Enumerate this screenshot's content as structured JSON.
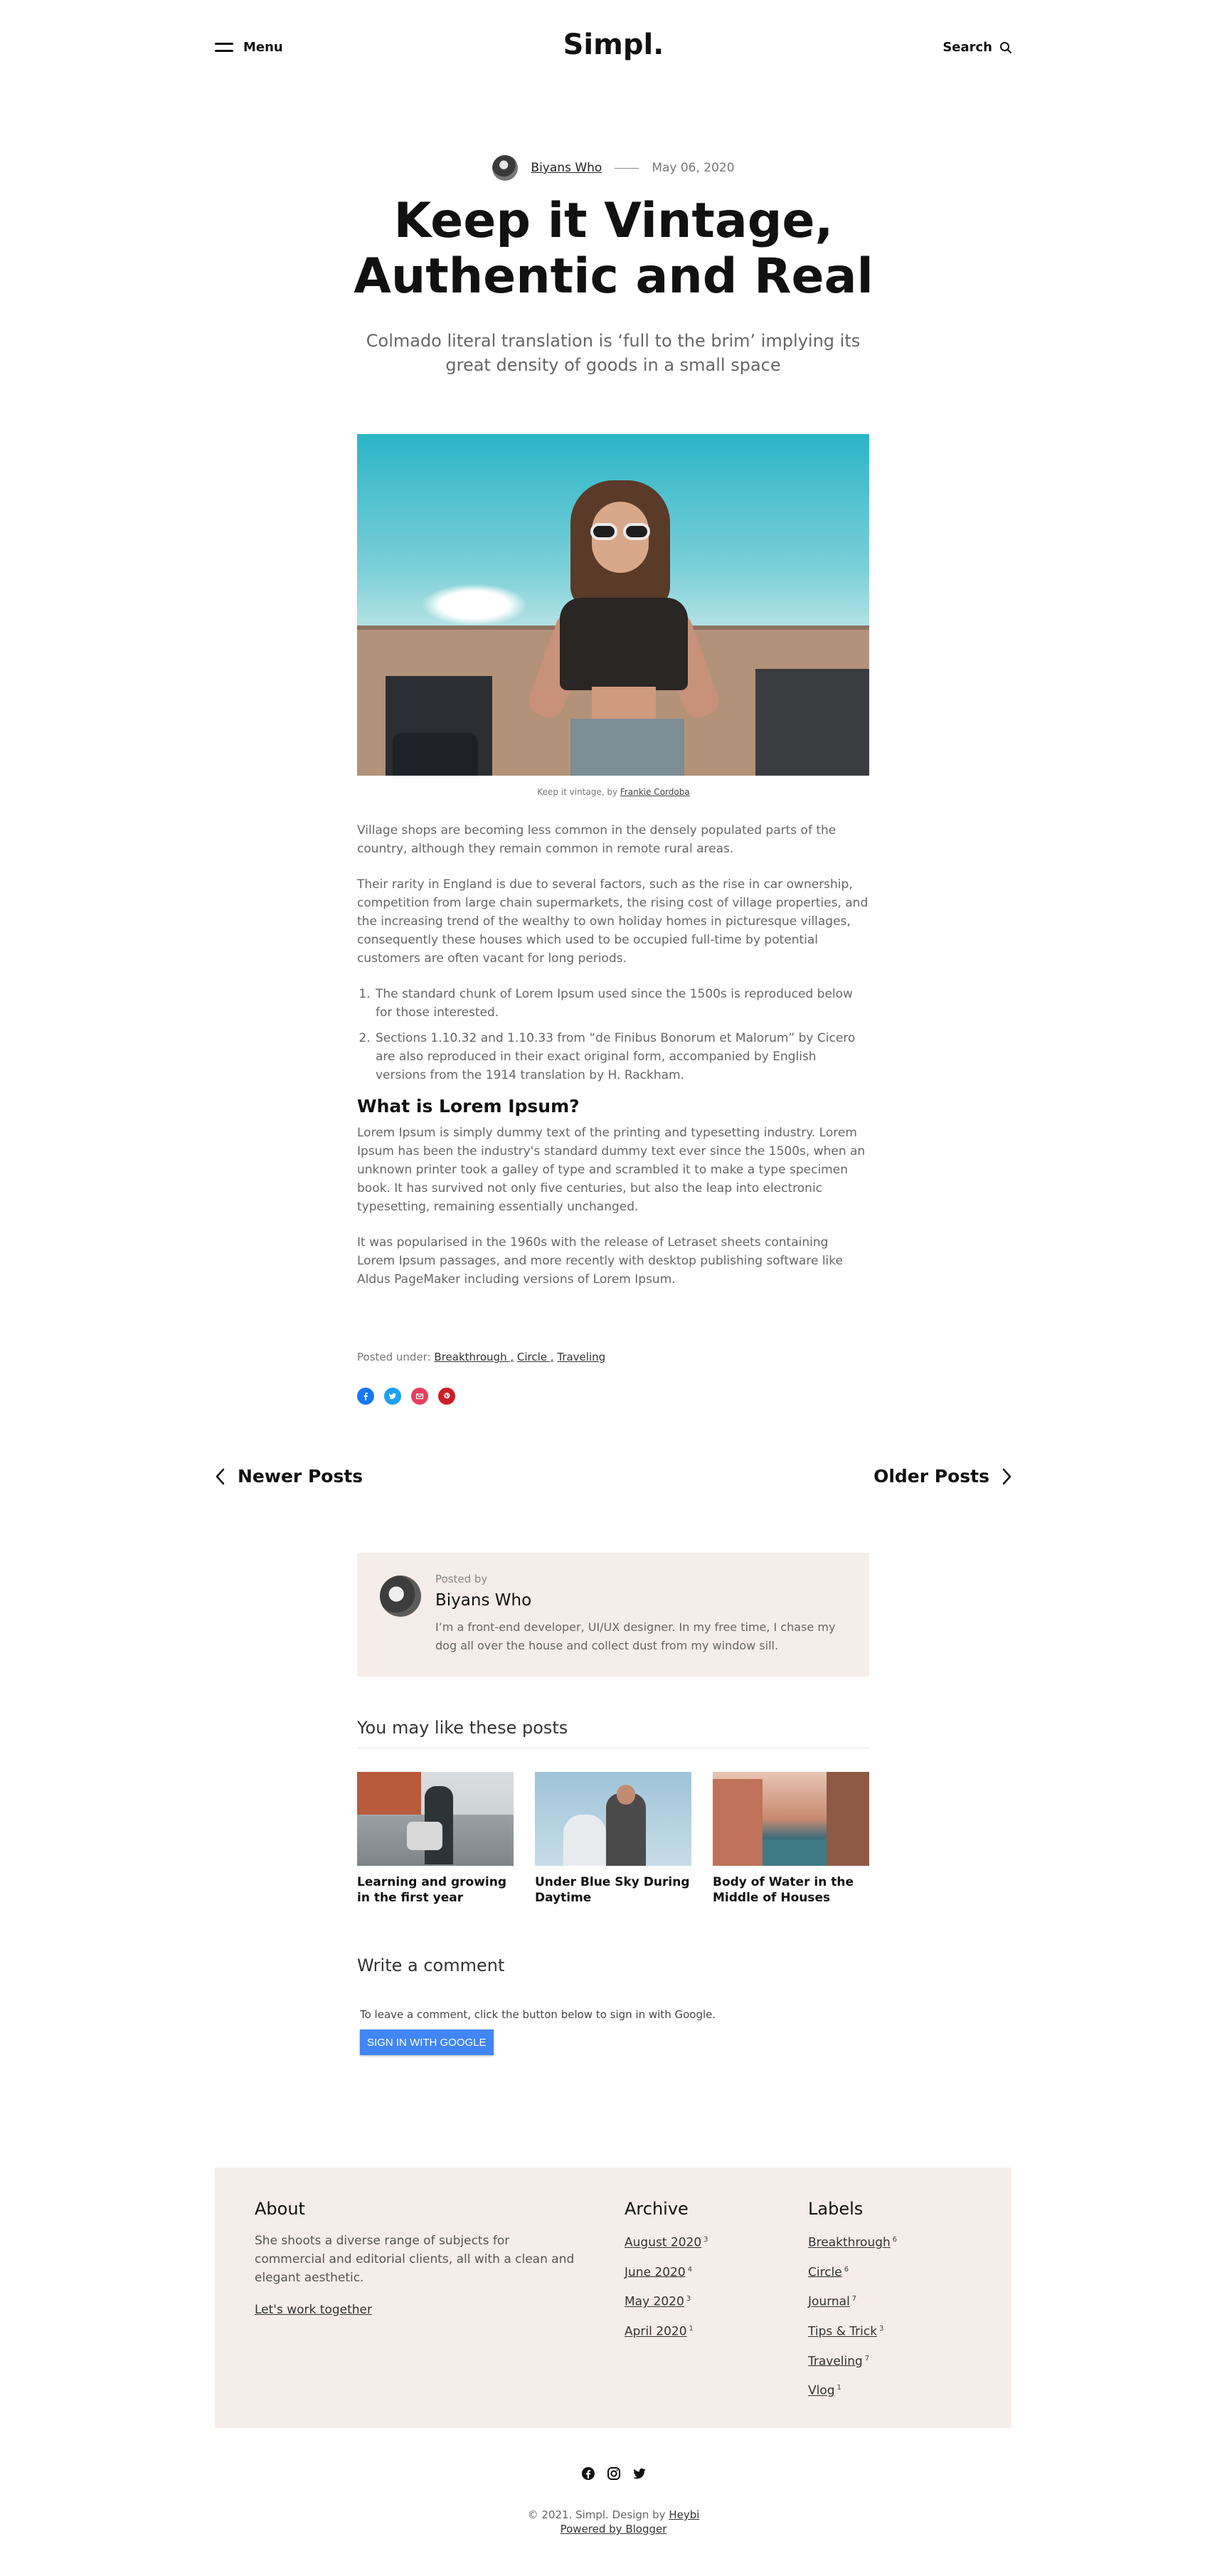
{
  "header": {
    "menu_label": "Menu",
    "logo": "Simpl.",
    "search_label": "Search"
  },
  "post": {
    "author": "Biyans Who",
    "date": "May 06, 2020",
    "title_line1": "Keep it Vintage,",
    "title_line2": "Authentic and Real",
    "subtitle": "Colmado literal translation is ‘full to the brim’ implying its great density of goods in a small space",
    "caption_prefix": "Keep it vintage, by ",
    "caption_credit": "Frankie Cordoba",
    "paragraphs": [
      "Village shops are becoming less common in the densely populated parts of the country, although they remain common in remote rural areas.",
      "Their rarity in England is due to several factors, such as the rise in car ownership, competition from large chain supermarkets, the rising cost of village properties, and the increasing trend of the wealthy to own holiday homes in picturesque villages, consequently these houses which used to be occupied full-time by potential customers are often vacant for long periods."
    ],
    "list": [
      "The standard chunk of Lorem Ipsum used since the 1500s is reproduced below for those interested.",
      "Sections 1.10.32 and 1.10.33 from “de Finibus Bonorum et Malorum” by Cicero are also reproduced in their exact original form, accompanied by English versions from the 1914 translation by H. Rackham."
    ],
    "heading": "What is Lorem Ipsum?",
    "paragraphs2": [
      "Lorem Ipsum is simply dummy text of the printing and typesetting industry. Lorem Ipsum has been the industry's standard dummy text ever since the 1500s, when an unknown printer took a galley of type and scrambled it to make a type specimen book. It has survived not only five centuries, but also the leap into electronic typesetting, remaining essentially unchanged.",
      "It was popularised in the 1960s with the release of Letraset sheets containing Lorem Ipsum passages, and more recently with desktop publishing software like Aldus PageMaker including versions of Lorem Ipsum."
    ],
    "posted_under_label": "Posted under: ",
    "tags": [
      "Breakthrough ,",
      "Circle ,",
      "Traveling"
    ]
  },
  "share": {
    "facebook_color": "#1877f2",
    "twitter_color": "#1da1f2",
    "email_color": "#e4405f",
    "pinterest_color": "#cb2027",
    "icons": [
      "facebook-icon",
      "twitter-icon",
      "email-icon",
      "pinterest-icon"
    ]
  },
  "pager": {
    "newer": "Newer Posts",
    "older": "Older Posts"
  },
  "author_box": {
    "posted_by": "Posted by",
    "name": "Biyans Who",
    "bio": "I’m a front-end developer, UI/UX designer. In my free time, I chase my dog all over the house and collect dust from my window sill."
  },
  "related": {
    "title": "You may like these posts",
    "items": [
      {
        "title": "Learning and growing in the first year"
      },
      {
        "title": "Under Blue Sky During Daytime"
      },
      {
        "title": "Body of Water in the Middle of Houses"
      }
    ]
  },
  "comments": {
    "title": "Write a comment",
    "note": "To leave a comment, click the button below to sign in with Google.",
    "button": "SIGN IN WITH GOOGLE"
  },
  "footer": {
    "about_title": "About",
    "about_text": "She shoots a diverse range of subjects for commercial and editorial clients, all with a clean and elegant aesthetic.",
    "about_link": "Let's work together",
    "archive_title": "Archive",
    "archive": [
      {
        "label": "August 2020",
        "count": "3"
      },
      {
        "label": "June 2020",
        "count": "4"
      },
      {
        "label": "May 2020",
        "count": "3"
      },
      {
        "label": "April 2020",
        "count": "1"
      }
    ],
    "labels_title": "Labels",
    "labels": [
      {
        "label": "Breakthrough",
        "count": "6"
      },
      {
        "label": "Circle",
        "count": "6"
      },
      {
        "label": "Journal",
        "count": "7"
      },
      {
        "label": "Tips & Trick",
        "count": "3"
      },
      {
        "label": "Traveling",
        "count": "7"
      },
      {
        "label": "Vlog",
        "count": "1"
      }
    ],
    "copyright_prefix": "© 2021. Simpl. Design by ",
    "designer": "Heybi",
    "powered": "Powered by Blogger"
  }
}
